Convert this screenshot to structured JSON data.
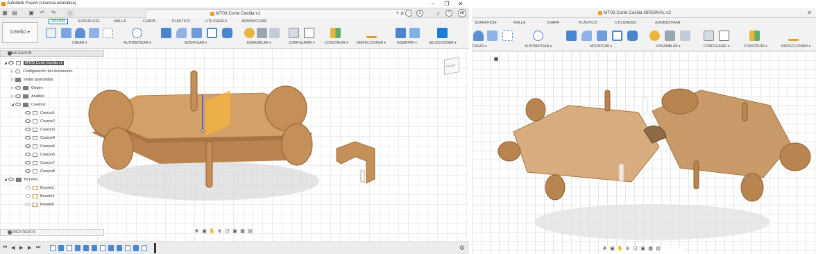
{
  "left": {
    "title": "Autodesk Fusion (Licencia educativa)",
    "doc_tab_title": "MT03 Corte Cecilia v1",
    "avatar": "AB",
    "notifications": "1",
    "workspace": "DISEÑO",
    "ribbon_tabs": [
      "SÓLIDO",
      "SUPERFICIE",
      "MALLA",
      "CHAPA",
      "PLÁSTICO",
      "UTILIDADES",
      "ADMINISTRAR"
    ],
    "ribbon_groups": [
      "CREAR",
      "AUTOMATIZAR",
      "MODIFICAR",
      "ENSAMBLAR",
      "CONFIGURAR",
      "CONSTRUIR",
      "INSPECCIONAR",
      "INSERTAR",
      "SELECCIONAR"
    ],
    "navigator_title": "NAVEGADOR",
    "tree": {
      "root": "MT03 Corte Cecilia v1",
      "settings": "Configuración del documento",
      "saved_views": "Vistas guardadas",
      "origin": "Origen",
      "analysis": "Análisis",
      "bodies_folder": "Cuerpos",
      "bodies": [
        "Cuerpo1",
        "Cuerpo2",
        "Cuerpo3",
        "Cuerpo4",
        "Cuerpo5",
        "Cuerpo6",
        "Cuerpo7",
        "Cuerpo8"
      ],
      "sketches_folder": "Bocetos",
      "sketches": [
        "Boceto2",
        "Boceto4",
        "Boceto5"
      ]
    },
    "comments_label": "COMENTARIOS",
    "viewcube_label": "FRONT"
  },
  "right": {
    "doc_tab_title": "MT03 Corte Cecilia ORIGINAL v2",
    "ribbon_tabs": [
      "SUPERFICIE",
      "MALLA",
      "CHAPA",
      "PLÁSTICO",
      "UTILIDADES",
      "ADMINISTRAR"
    ],
    "ribbon_groups": [
      "CREAR",
      "AUTOMATIZAR",
      "MODIFICAR",
      "ENSAMBLAR",
      "CONFIGURAR",
      "CONSTRUIR",
      "INSPECCIONAR"
    ]
  },
  "colors": {
    "accent": "#0b6ec8",
    "wood": "#d3a06a",
    "wood_dark": "#a8743f",
    "plane": "#f5b43c",
    "axis_blue": "#3b4fd8"
  }
}
